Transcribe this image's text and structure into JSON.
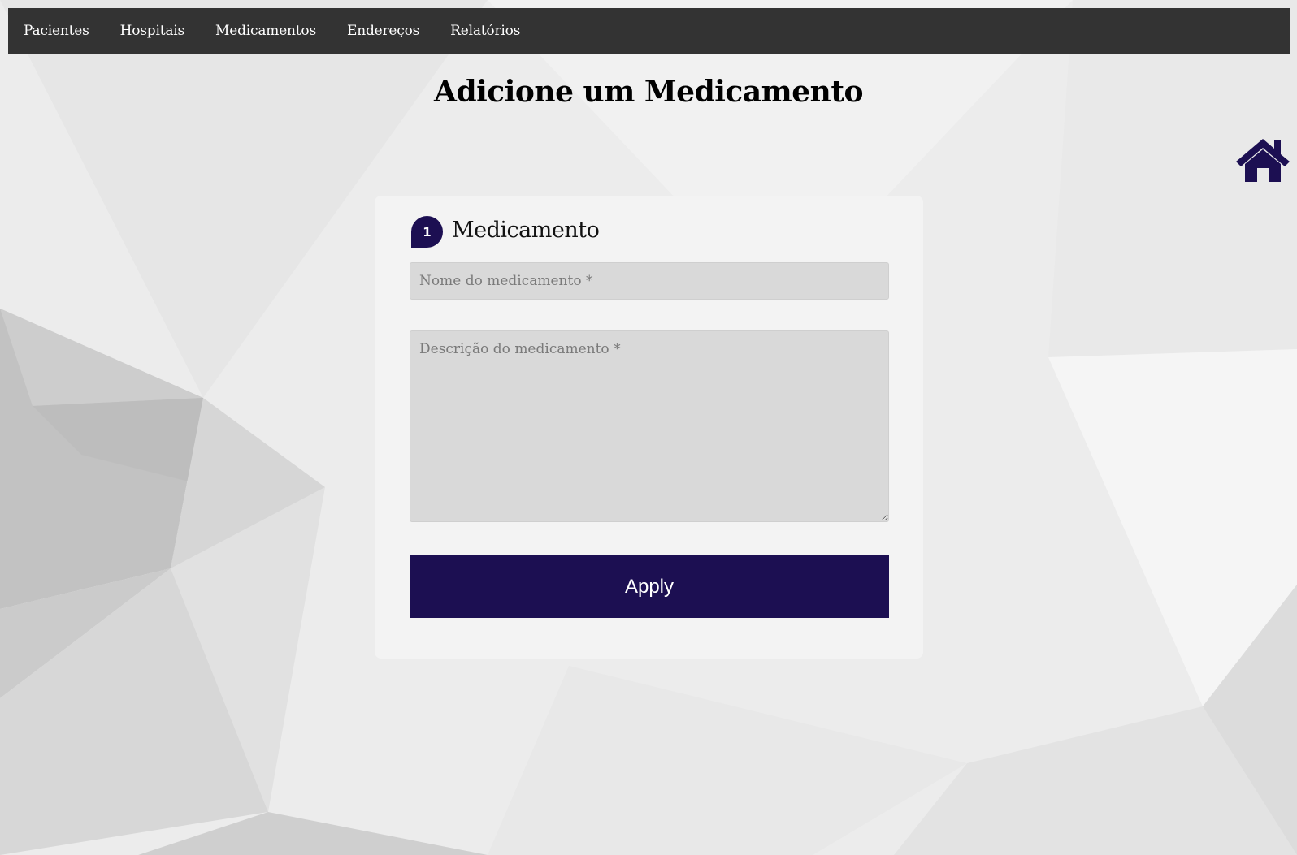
{
  "nav": {
    "items": [
      {
        "label": "Pacientes"
      },
      {
        "label": "Hospitais"
      },
      {
        "label": "Medicamentos"
      },
      {
        "label": "Endereços"
      },
      {
        "label": "Relatórios"
      }
    ]
  },
  "page": {
    "title": "Adicione um Medicamento"
  },
  "home_icon": "home-icon",
  "form": {
    "step_number": "1",
    "section_title": "Medicamento",
    "name_value": "",
    "name_placeholder": "Nome do medicamento *",
    "description_value": "",
    "description_placeholder": "Descrição do medicamento *",
    "apply_label": "Apply"
  },
  "colors": {
    "navbar": "#333333",
    "accent": "#1c0f52",
    "card": "#f3f3f3",
    "field": "#d9d9d9"
  }
}
